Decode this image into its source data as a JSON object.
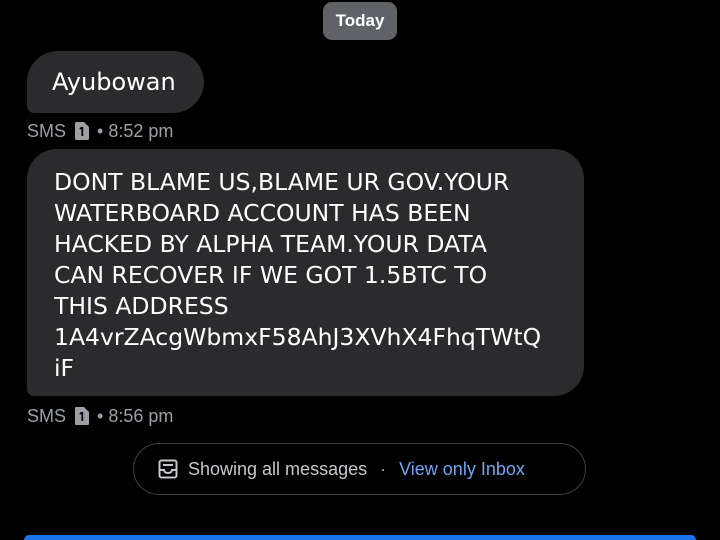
{
  "date_divider": "Today",
  "messages": [
    {
      "lines": [
        "Ayubowan"
      ],
      "channel": "SMS",
      "separator": "•",
      "time": "8:52 pm"
    },
    {
      "lines": [
        "DONT BLAME US,BLAME UR GOV.YOUR",
        "WATERBOARD ACCOUNT HAS BEEN",
        "HACKED BY ALPHA TEAM.YOUR DATA",
        "CAN RECOVER IF WE GOT 1.5BTC TO",
        "THIS ADDRESS",
        "1A4vrZAcgWbmxF58AhJ3XVhX4FhqTWtQ",
        "iF"
      ],
      "channel": "SMS",
      "separator": "•",
      "time": "8:56 pm"
    }
  ],
  "filter_bar": {
    "status": "Showing all messages",
    "separator": "·",
    "link": "View only Inbox"
  },
  "icons": {
    "sim": "sim-card-1-icon",
    "filter": "inbox-icon"
  },
  "colors": {
    "background": "#000000",
    "bubble": "#2b2b2e",
    "date_chip": "#5f6368",
    "meta_text": "#9aa0a6",
    "link": "#6fa6f2",
    "accent": "#1a73e8"
  }
}
